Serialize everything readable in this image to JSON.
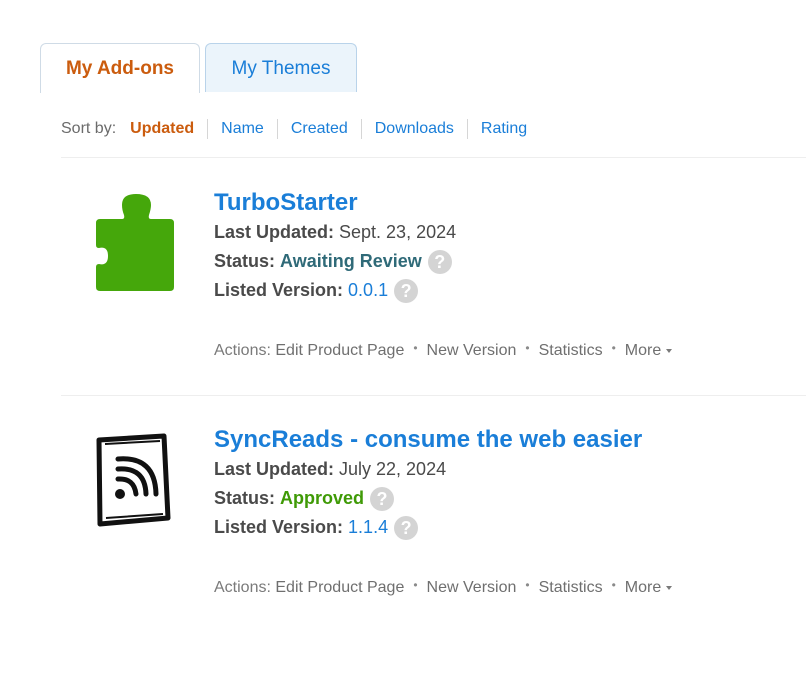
{
  "tabs": {
    "addons": "My Add-ons",
    "themes": "My Themes"
  },
  "sort": {
    "label": "Sort by:",
    "options": [
      "Updated",
      "Name",
      "Created",
      "Downloads",
      "Rating"
    ],
    "active": "Updated"
  },
  "addons": [
    {
      "title": "TurboStarter",
      "last_updated_label": "Last Updated:",
      "last_updated": "Sept. 23, 2024",
      "status_label": "Status:",
      "status": "Awaiting Review",
      "version_label": "Listed Version:",
      "version": "0.0.1",
      "icon": "puzzle-piece-icon",
      "icon_color": "#45a70b",
      "status_color": "#2f6a78"
    },
    {
      "title": "SyncReads - consume the web easier",
      "last_updated_label": "Last Updated:",
      "last_updated": "July 22, 2024",
      "status_label": "Status:",
      "status": "Approved",
      "version_label": "Listed Version:",
      "version": "1.1.4",
      "icon": "rss-feed-icon",
      "status_color": "#3f9a06"
    }
  ],
  "actions": {
    "label": "Actions:",
    "edit": "Edit Product Page",
    "new_version": "New Version",
    "statistics": "Statistics",
    "more": "More",
    "separator": "•"
  },
  "help_glyph": "?"
}
